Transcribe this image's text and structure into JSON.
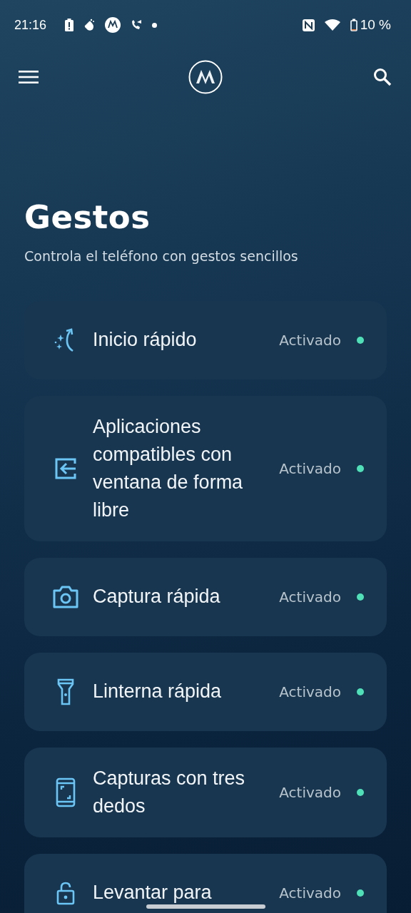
{
  "status_bar": {
    "time": "21:16",
    "battery": "10 %"
  },
  "title": "Gestos",
  "subtitle": "Controla el teléfono con gestos sencillos",
  "gestures": [
    {
      "kind": "sparkle-arc",
      "label": "Inicio rápido",
      "status": "Activado",
      "on": true
    },
    {
      "kind": "window-enter",
      "label": "Aplicaciones compatibles con ventana de forma libre",
      "status": "Activado",
      "on": true
    },
    {
      "kind": "camera",
      "label": "Captura rápida",
      "status": "Activado",
      "on": true
    },
    {
      "kind": "flashlight",
      "label": "Linterna rápida",
      "status": "Activado",
      "on": true
    },
    {
      "kind": "phone-corners",
      "label": "Capturas con tres dedos",
      "status": "Activado",
      "on": true
    },
    {
      "kind": "lock",
      "label": "Levantar para",
      "status": "Activado",
      "on": true
    }
  ]
}
